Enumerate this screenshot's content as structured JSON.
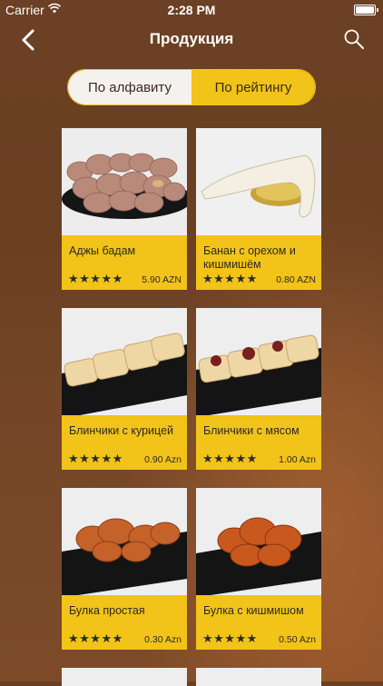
{
  "status": {
    "carrier": "Carrier",
    "time": "2:28 PM"
  },
  "nav": {
    "title": "Продукция"
  },
  "segment": {
    "alpha": "По алфавиту",
    "rating": "По рейтингу"
  },
  "products": [
    {
      "name": "Аджы бадам",
      "price": "5.90 AZN",
      "stars": "★★★★★"
    },
    {
      "name": "Банан с орехом и кишмишём",
      "price": "0.80 AZN",
      "stars": "★★★★★"
    },
    {
      "name": "Блинчики с курицей",
      "price": "0.90 Azn",
      "stars": "★★★★★"
    },
    {
      "name": "Блинчики с мясом",
      "price": "1.00 Azn",
      "stars": "★★★★★"
    },
    {
      "name": "Булка простая",
      "price": "0.30 Azn",
      "stars": "★★★★★"
    },
    {
      "name": "Булка с кишмишом",
      "price": "0.50 Azn",
      "stars": "★★★★★"
    }
  ]
}
